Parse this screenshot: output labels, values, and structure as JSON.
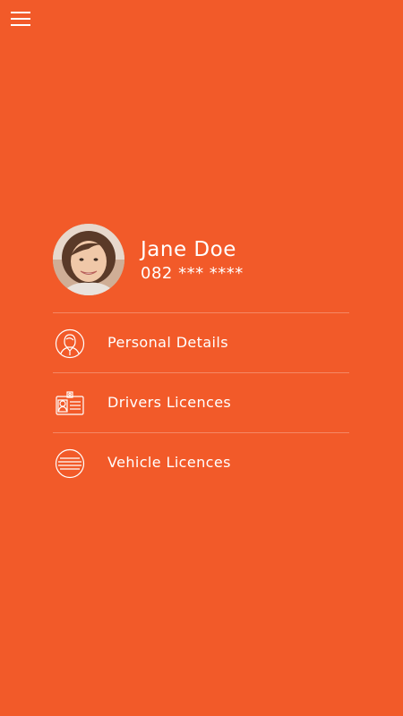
{
  "header": {
    "menu_icon": "hamburger-menu-icon"
  },
  "profile": {
    "name": "Jane Doe",
    "phone": "082 *** ****",
    "avatar_icon": "user-photo-avatar"
  },
  "menu": {
    "items": [
      {
        "label": "Personal Details",
        "icon": "person-icon"
      },
      {
        "label": "Drivers Licences",
        "icon": "id-card-icon"
      },
      {
        "label": "Vehicle Licences",
        "icon": "license-disc-icon"
      }
    ]
  },
  "colors": {
    "background": "#f25a29",
    "text": "#ffffff",
    "divider": "rgba(255,255,255,0.28)"
  }
}
